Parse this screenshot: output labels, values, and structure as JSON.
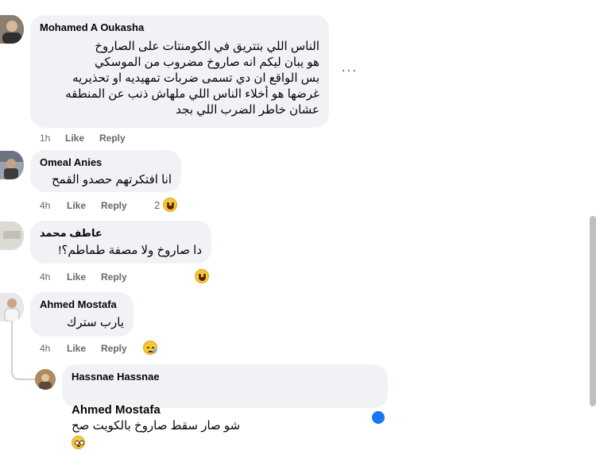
{
  "colors": {
    "bubble": "#f0f2f5",
    "meta": "#65676b",
    "accent": "#1877f2"
  },
  "comments": [
    {
      "author": "Mohamed A Oukasha",
      "text": "الناس اللي بتتريق في الكومنتات على الصاروخ\nهو يبان ليكم انه صاروخ مضروب من الموسكي\nبس الواقع ان دي تسمى ضربات تمهيديه او تحذيريه\nغرضها هو أخلاء الناس اللي ملهاش ذنب عن المنطقه\nعشان خاطر الضرب اللي بجد",
      "time": "1h",
      "like": "Like",
      "reply": "Reply",
      "more": "···"
    },
    {
      "author": "Omeal Anies",
      "text": "انا افتكرتهم حصدو القمح",
      "time": "4h",
      "like": "Like",
      "reply": "Reply",
      "reactions": "2",
      "reaction_icon": "laughing-emoji"
    },
    {
      "author": "عاطف محمد",
      "text": "دا صاروخ ولا مصفة طماطم؟!",
      "time": "4h",
      "like": "Like",
      "reply": "Reply",
      "reaction_icon": "laughing-emoji"
    },
    {
      "author": "Ahmed Mostafa",
      "text": "يارب سترك",
      "time": "4h",
      "like": "Like",
      "reply": "Reply",
      "reaction_icon": "sad-emoji"
    },
    {
      "author": "Hassnae Hassnae",
      "mention": "Ahmed Mostafa",
      "text": "شو صار سقط صاروخ بالكويت صح",
      "reaction_icon": "flushed-emoji"
    }
  ]
}
